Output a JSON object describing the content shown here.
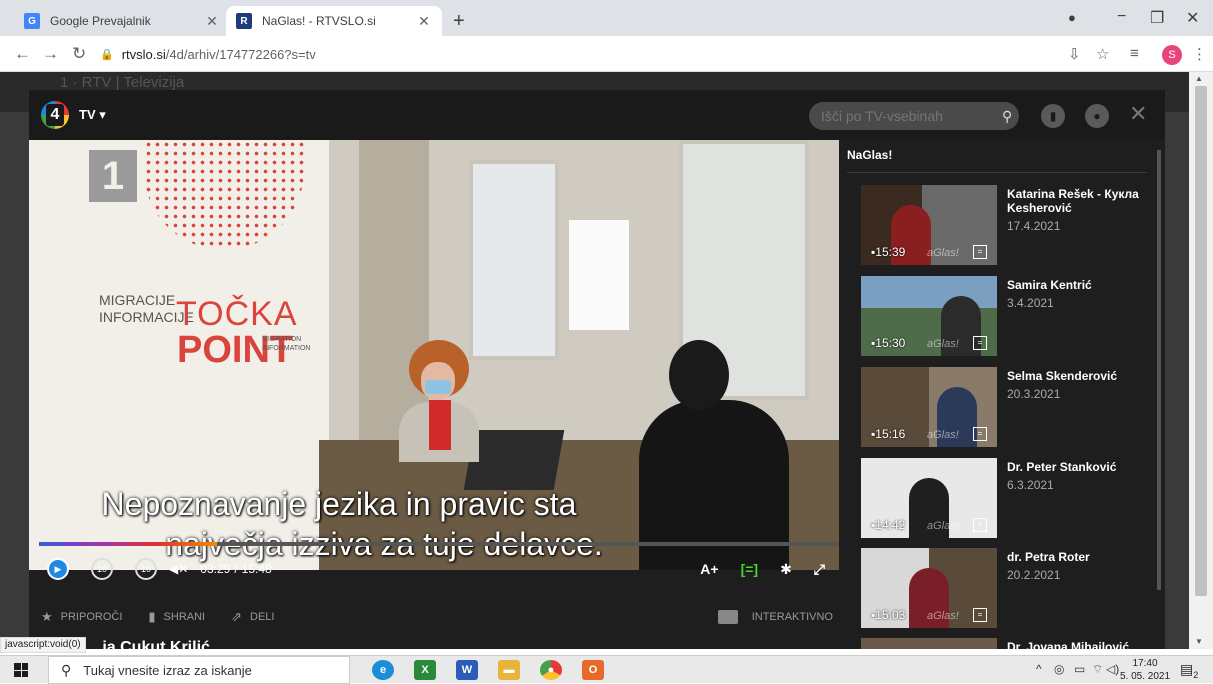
{
  "browser": {
    "tabs": [
      {
        "title": "Google Prevajalnik",
        "active": false
      },
      {
        "title": "NaGlas! - RTVSLO.si",
        "active": true
      }
    ],
    "new_tab": "+",
    "url_host": "rtvslo.si",
    "url_path": "/4d/arhiv/174772266?s=tv",
    "profile_initial": "S",
    "window_controls": {
      "minimize": "−",
      "maximize": "❐",
      "close": "✕"
    }
  },
  "site": {
    "bg_header_text": "1 · RTV | Televizija"
  },
  "player": {
    "section": "TV",
    "search_placeholder": "Išči po TV-vsebinah",
    "video": {
      "channel_number": "1",
      "poster_text_left": [
        "MIGRACIJE",
        "INFORMACIJE"
      ],
      "poster_tocka": "TOČKA",
      "poster_point": "POINT",
      "poster_text_en": [
        "MIGRATION",
        "INFORMATION"
      ],
      "subtitle_lines": [
        "Nepoznavanje jezika in pravic sta",
        "največja izziva za tuje delavce."
      ]
    },
    "progress": 0.223,
    "time_current": "03:29",
    "time_total": "15:48",
    "time_sep": "/",
    "skip_back": "10",
    "skip_fwd": "10",
    "text_size": "A+",
    "subtitles_btn": "[=]",
    "actions": {
      "recommend": "PRIPOROČI",
      "save": "SHRANI",
      "share": "DELI",
      "interactive": "INTERAKTIVNO"
    },
    "bottom_title": "...ia Cukut Krilić"
  },
  "playlist": {
    "title": "NaGlas!",
    "watermark": "aGlas!",
    "items": [
      {
        "name": "Katarina Rešek - Кукла Kesherović",
        "date": "17.4.2021",
        "duration": "15:39"
      },
      {
        "name": "Samira Kentrić",
        "date": "3.4.2021",
        "duration": "15:30"
      },
      {
        "name": "Selma Skenderović",
        "date": "20.3.2021",
        "duration": "15:16"
      },
      {
        "name": "Dr. Peter Stanković",
        "date": "6.3.2021",
        "duration": "14:42"
      },
      {
        "name": "dr. Petra Roter",
        "date": "20.2.2021",
        "duration": "15:03"
      },
      {
        "name": "Dr. Jovana Mihajlović",
        "date": "",
        "duration": ""
      }
    ]
  },
  "status_url": "javascript:void(0)",
  "taskbar": {
    "search_placeholder": "Tukaj vnesite izraz za iskanje",
    "time": "17:40",
    "date": "5. 05. 2021",
    "notification_count": "2"
  }
}
